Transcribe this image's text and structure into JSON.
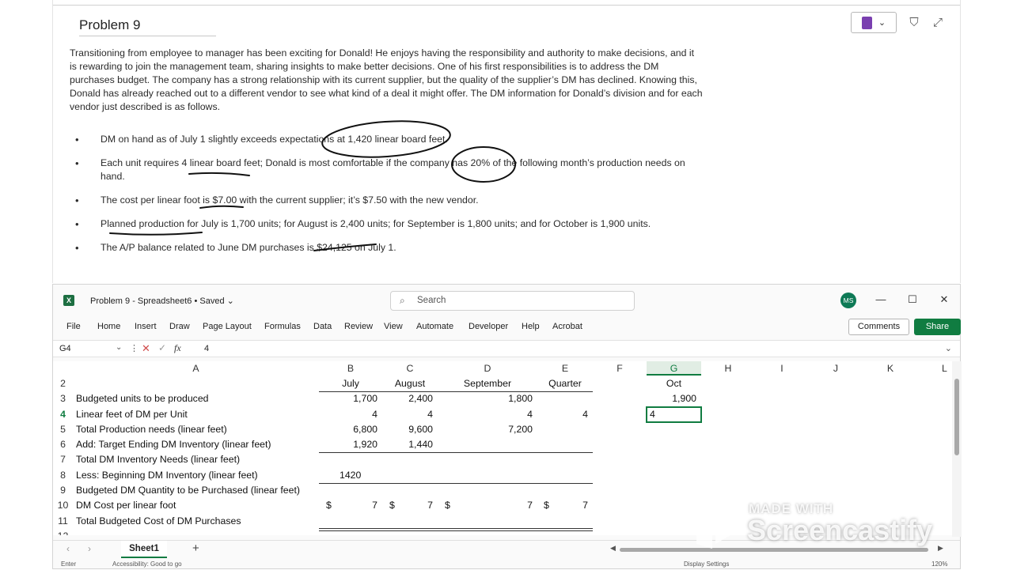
{
  "document": {
    "title": "Problem 9",
    "intro": "Transitioning from employee to manager has been exciting for Donald! He enjoys having the responsibility and authority to make decisions, and it is rewarding to join the management team, sharing insights to make better decisions. One of his first responsibilities is to address the DM purchases budget. The company has a strong relationship with its current supplier, but the quality of the supplier’s DM has declined. Knowing this, Donald has already reached out to a different vendor to see what kind of a deal it might offer. The DM information for Donald’s division and for each vendor just described is as follows.",
    "bullets": [
      "DM on hand as of July 1 slightly exceeds expectations at 1,420 linear board feet.",
      "Each unit requires 4 linear board feet; Donald is most comfortable if the company has 20% of the following month’s production needs on hand.",
      "The cost per linear foot is $7.00 with the current supplier; it’s $7.50 with the new vendor.",
      "Planned production for July is 1,700 units; for August is 2,400 units; for September is 1,800 units; and for October is 1,900 units.",
      "The A/P balance related to June DM purchases is $24,125 on July 1."
    ]
  },
  "excel": {
    "doc_name": "Problem 9 - Spreadsheet6 • Saved ⌄",
    "search_placeholder": "Search",
    "avatar": "MS",
    "menu": [
      "File",
      "Home",
      "Insert",
      "Draw",
      "Page Layout",
      "Formulas",
      "Data",
      "Review",
      "View",
      "Automate",
      "Developer",
      "Help",
      "Acrobat"
    ],
    "comments": "Comments",
    "share": "Share",
    "name_box": "G4",
    "formula_value": "4",
    "columns": [
      "A",
      "B",
      "C",
      "D",
      "E",
      "F",
      "G",
      "H",
      "I",
      "J",
      "K",
      "L"
    ],
    "rows": [
      "2",
      "3",
      "4",
      "5",
      "6",
      "7",
      "8",
      "9",
      "10",
      "11",
      "12"
    ],
    "headers": {
      "B": "July",
      "C": "August",
      "D": "September",
      "E": "Quarter",
      "G": "Oct"
    },
    "labels": [
      "Budgeted units to be produced",
      "Linear feet of DM per Unit",
      "Total Production needs (linear feet)",
      "Add:  Target Ending DM Inventory (linear feet)",
      "Total DM Inventory Needs (linear feet)",
      "Less: Beginning DM Inventory (linear feet)",
      "Budgeted DM Quantity to be Purchased (linear feet)",
      "DM Cost per linear foot",
      "Total Budgeted Cost of DM Purchases"
    ],
    "values": {
      "units": {
        "B": "1,700",
        "C": "2,400",
        "D": "1,800",
        "G": "1,900"
      },
      "feet_per_unit": {
        "B": "4",
        "C": "4",
        "D": "4",
        "E": "4",
        "G": "4"
      },
      "production_needs": {
        "B": "6,800",
        "C": "9,600",
        "D": "7,200"
      },
      "target_ending": {
        "B": "1,920",
        "C": "1,440"
      },
      "beginning_inventory": {
        "B": "1420"
      },
      "cost_symbol": "$",
      "cost": {
        "B": "7",
        "C": "7",
        "D": "7",
        "E": "7"
      }
    },
    "sheet_tab": "Sheet1",
    "status": {
      "mode": "Enter",
      "accessibility": "Accessibility: Good to go",
      "display": "Display Settings",
      "zoom": "120%"
    }
  },
  "watermark": {
    "line1": "MADE WITH",
    "line2": "Screencastify"
  }
}
